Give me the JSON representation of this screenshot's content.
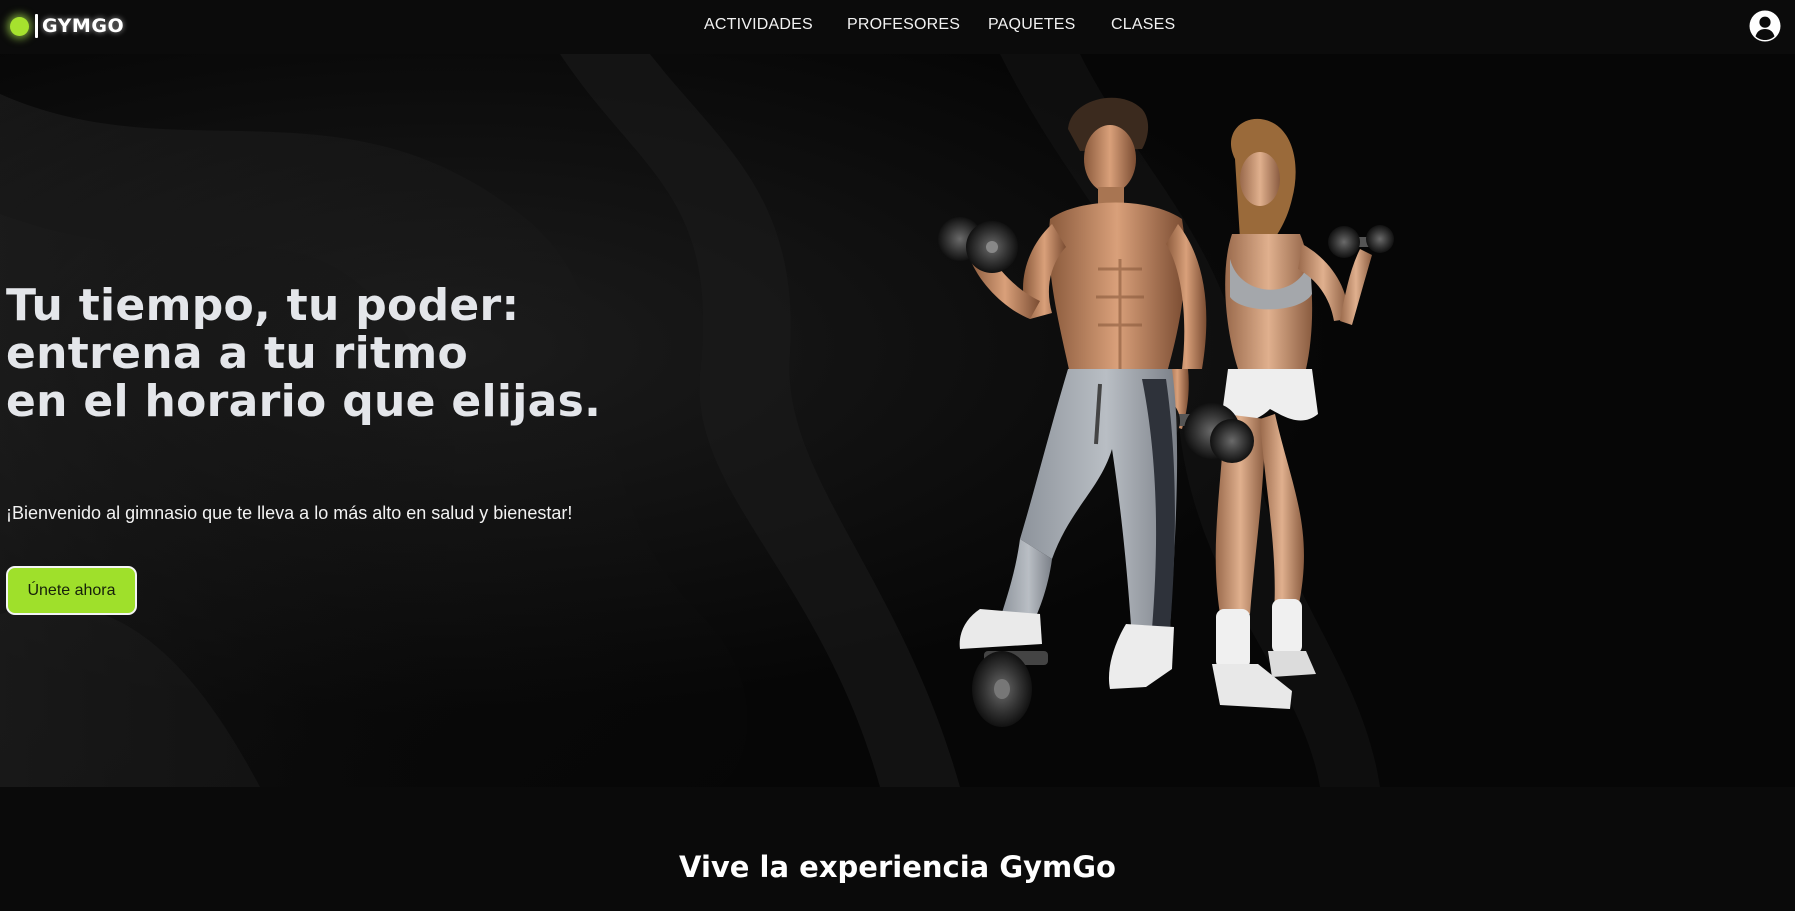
{
  "brand": {
    "logo_text": "GYMGO",
    "accent_color": "#a6e22e"
  },
  "nav": {
    "links": [
      {
        "label": "ACTIVIDADES"
      },
      {
        "label": "PROFESORES"
      },
      {
        "label": "PAQUETES"
      },
      {
        "label": "CLASES"
      }
    ],
    "user_icon": "user-circle-icon"
  },
  "hero": {
    "title_lines": [
      "Tu tiempo, tu poder:",
      "entrena a tu ritmo",
      "en el horario que elijas."
    ],
    "subtitle": "¡Bienvenido al gimnasio que te lleva a lo más alto en salud y bienestar!",
    "cta_label": "Únete ahora",
    "image_icon": "athletes-with-dumbbells-image"
  },
  "experience": {
    "title": "Vive la experiencia GymGo"
  }
}
